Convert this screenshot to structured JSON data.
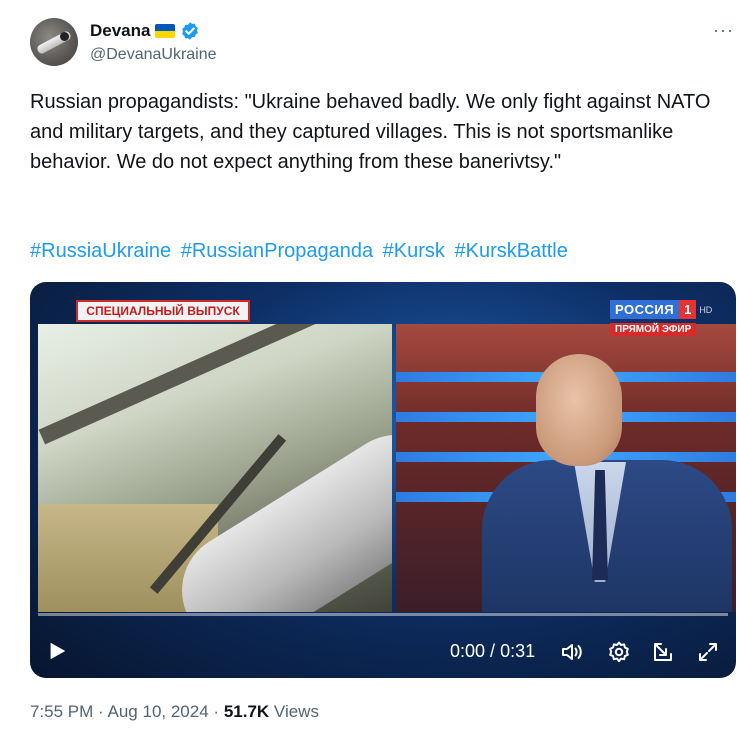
{
  "author": {
    "display_name": "Devana",
    "handle": "@DevanaUkraine",
    "avatar_icon": "avatar-photo",
    "flag_icon": "ukraine-flag-icon",
    "verified_icon": "verified-badge-icon"
  },
  "more_icon": "more-options-icon",
  "more_label": "···",
  "post": {
    "text": "Russian propagandists: \"Ukraine behaved badly. We only fight against NATO and military targets, and they captured villages. This is not sportsmanlike behavior. We do not expect anything from these banerivtsy.\"",
    "hashtags": [
      "#RussiaUkraine",
      "#RussianPropaganda",
      "#Kursk",
      "#KurskBattle"
    ]
  },
  "video": {
    "banner_text": "СПЕЦИАЛЬНЫЙ ВЫПУСК",
    "channel_name": "РОССИЯ",
    "channel_number": "1",
    "channel_hd": "HD",
    "live_label": "ПРЯМОЙ ЭФИР",
    "time_current": "0:00",
    "time_total": "0:31",
    "time_separator": " / ",
    "progress": 0,
    "icons": {
      "play": "play-icon",
      "volume": "volume-icon",
      "settings": "gear-icon",
      "popout": "popout-icon",
      "fullscreen": "fullscreen-icon"
    }
  },
  "meta": {
    "time": "7:55 PM",
    "date": "Aug 10, 2024",
    "separator": "·",
    "views_count": "51.7K",
    "views_label": "Views"
  },
  "colors": {
    "link": "#1d9bf0",
    "secondary_text": "#536471",
    "primary_text": "#0f1419",
    "verified": "#1d9bf0",
    "flag_blue": "#0057b7",
    "flag_yellow": "#ffd700"
  }
}
